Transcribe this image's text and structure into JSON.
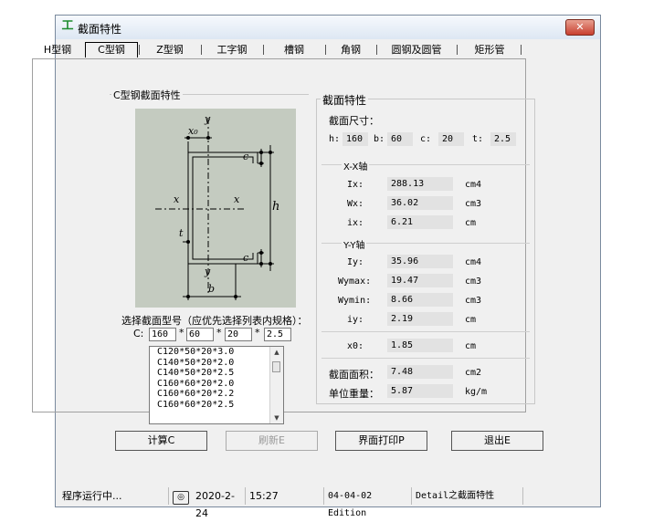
{
  "window": {
    "title": "截面特性",
    "close_label": "✕"
  },
  "tabs": [
    {
      "label": "H型钢",
      "active": false
    },
    {
      "label": "C型钢",
      "active": true
    },
    {
      "label": "Z型钢",
      "active": false
    },
    {
      "label": "工字钢",
      "active": false
    },
    {
      "label": "槽钢",
      "active": false
    },
    {
      "label": "角钢",
      "active": false
    },
    {
      "label": "圆钢及圆管",
      "active": false
    },
    {
      "label": "矩形管",
      "active": false
    }
  ],
  "left_group": {
    "title": "C型钢截面特性"
  },
  "diagram": {
    "labels": {
      "y_top": "y",
      "y_bottom": "y",
      "x_left": "x",
      "x_right": "x",
      "x0": "x₀",
      "c_top": "c",
      "c_bottom": "c",
      "h": "h",
      "t": "t",
      "b": "b"
    }
  },
  "select": {
    "prompt": "选择截面型号（应优先选择列表内规格）：",
    "c_label": "C:",
    "times": "*",
    "inputs": [
      "160",
      "60",
      "20",
      "2.5"
    ]
  },
  "list": {
    "items": [
      "C120*50*20*3.0",
      "C140*50*20*2.0",
      "C140*50*20*2.5",
      "C160*60*20*2.0",
      "C160*60*20*2.2",
      "C160*60*20*2.5"
    ]
  },
  "right_group": {
    "title": "截面特性",
    "size_label": "截面尺寸：",
    "dims": [
      {
        "label": "h:",
        "value": "160"
      },
      {
        "label": "b:",
        "value": "60"
      },
      {
        "label": "c:",
        "value": "20"
      },
      {
        "label": "t:",
        "value": "2.5"
      }
    ],
    "xx_axis": "X-X轴",
    "yy_axis": "Y-Y轴",
    "xx": [
      {
        "label": "Ix:",
        "value": "288.13",
        "unit": "cm4"
      },
      {
        "label": "Wx:",
        "value": "36.02",
        "unit": "cm3"
      },
      {
        "label": "ix:",
        "value": "6.21",
        "unit": "cm"
      }
    ],
    "yy": [
      {
        "label": "Iy:",
        "value": "35.96",
        "unit": "cm4"
      },
      {
        "label": "Wymax:",
        "value": "19.47",
        "unit": "cm3"
      },
      {
        "label": "Wymin:",
        "value": "8.66",
        "unit": "cm3"
      },
      {
        "label": "iy:",
        "value": "2.19",
        "unit": "cm"
      }
    ],
    "x0": {
      "label": "x0:",
      "value": "1.85",
      "unit": "cm"
    },
    "area": {
      "label": "截面面积：",
      "value": "7.48",
      "unit": "cm2"
    },
    "weight": {
      "label": "单位重量：",
      "value": "5.87",
      "unit": "kg/m"
    }
  },
  "buttons": {
    "calc": "计算C",
    "refresh": "刷新E",
    "print": "界面打印P",
    "exit": "退出E"
  },
  "status": {
    "running": "程序运行中...",
    "date": "2020-2-24",
    "time": "15:27",
    "edition": "04-04-02 Edition",
    "detail": "Detail之截面特性"
  }
}
